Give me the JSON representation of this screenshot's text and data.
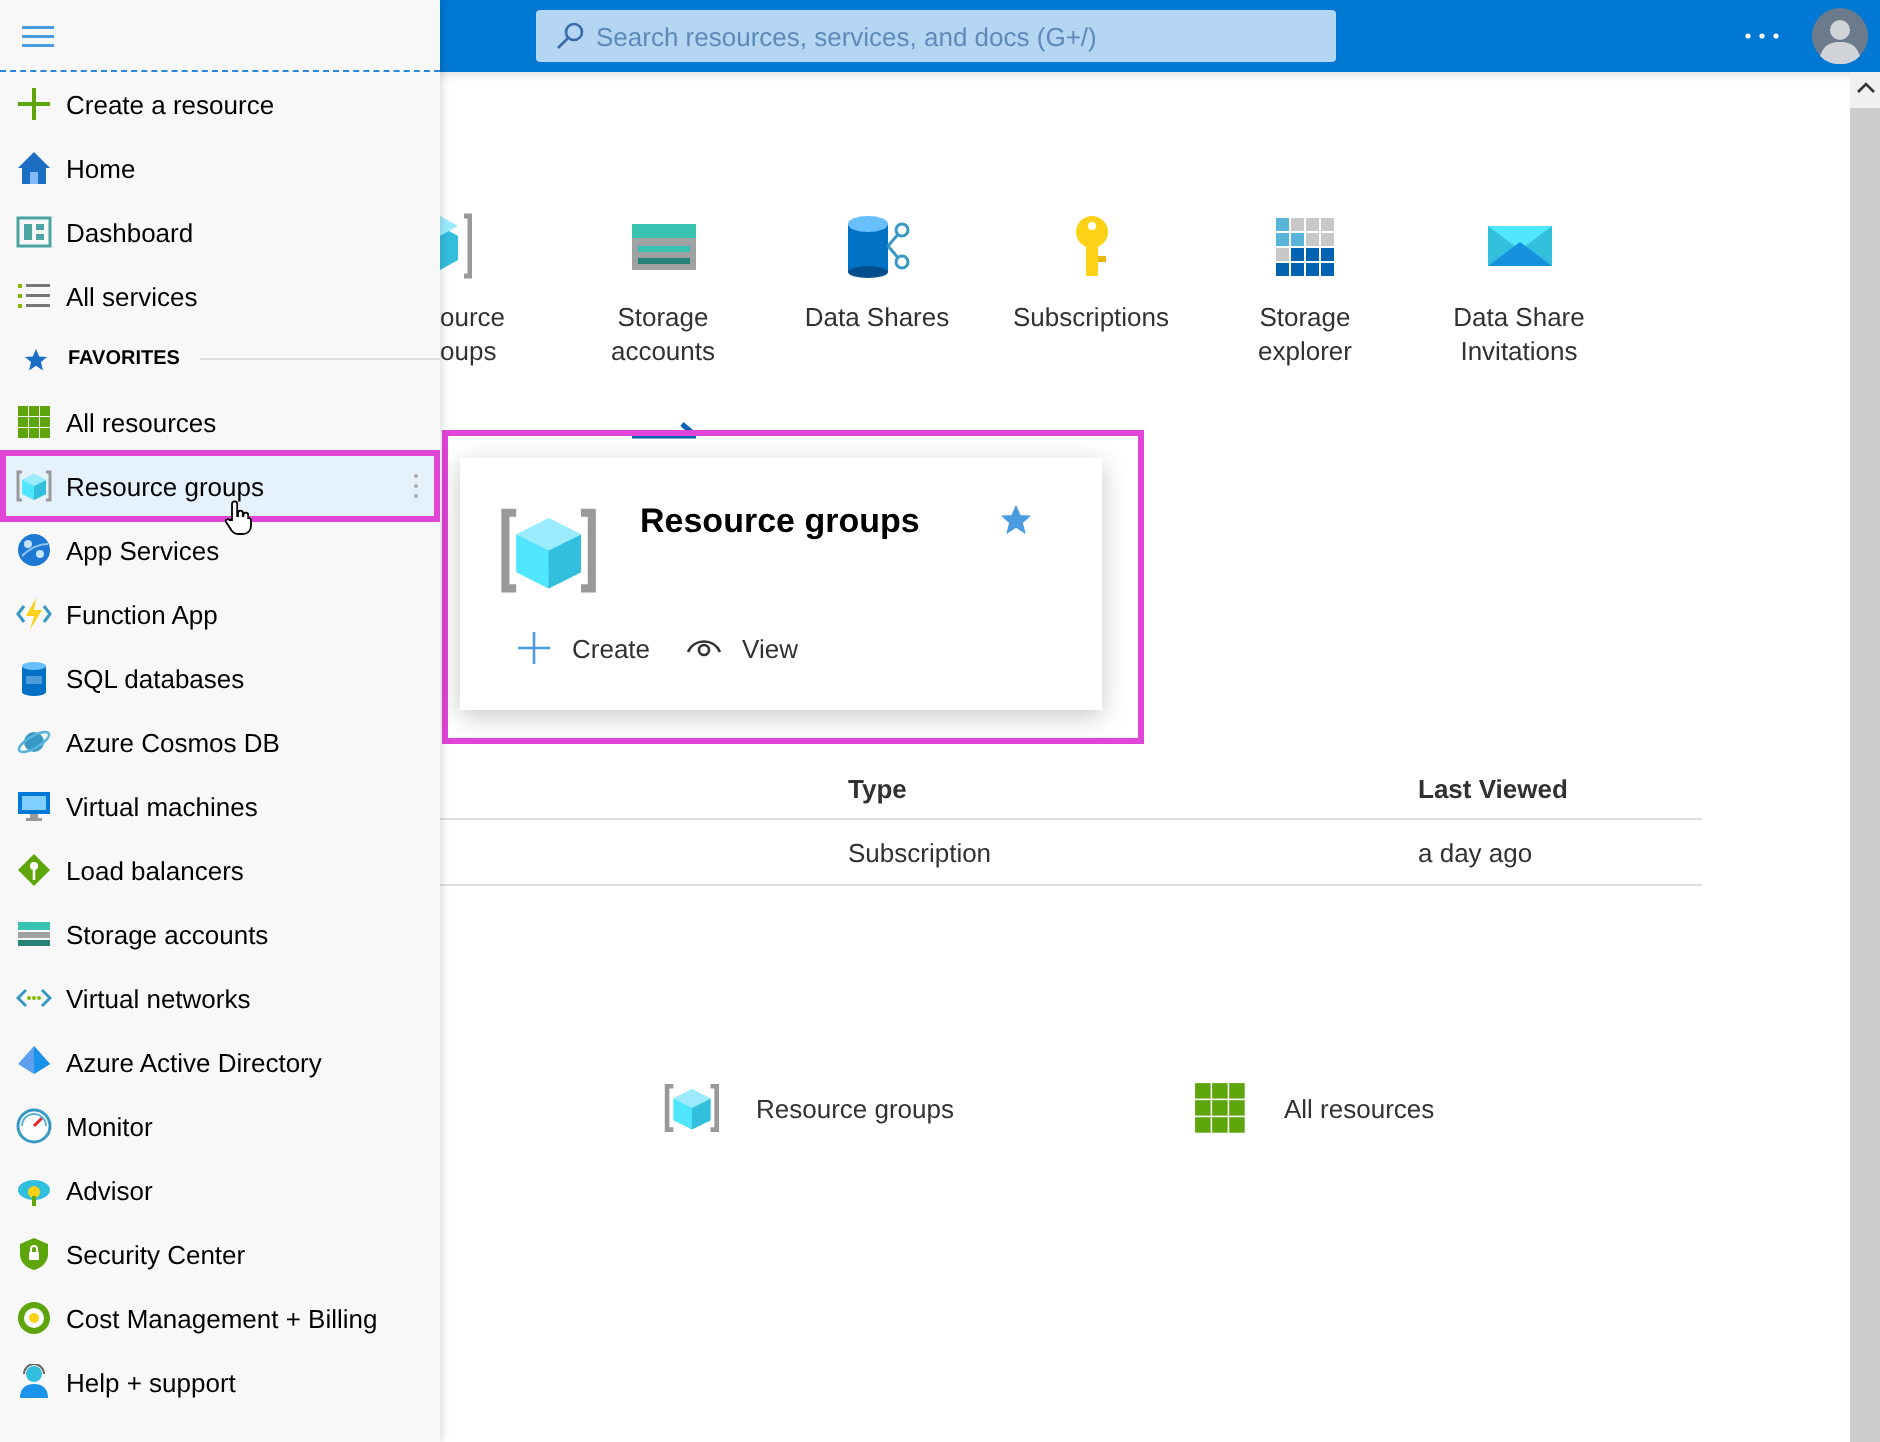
{
  "top_bar": {
    "search": {
      "placeholder": "Search resources, services, and docs (G+/)"
    }
  },
  "sidebar": {
    "items": [
      {
        "label": "Create a resource",
        "selected": false
      },
      {
        "label": "Home",
        "selected": false
      },
      {
        "label": "Dashboard",
        "selected": false
      },
      {
        "label": "All services",
        "selected": false
      }
    ],
    "favorites_heading": "FAVORITES",
    "favorites": [
      {
        "label": "All resources",
        "selected": false
      },
      {
        "label": "Resource groups",
        "selected": true
      },
      {
        "label": "App Services",
        "selected": false
      },
      {
        "label": "Function App",
        "selected": false
      },
      {
        "label": "SQL databases",
        "selected": false
      },
      {
        "label": "Azure Cosmos DB",
        "selected": false
      },
      {
        "label": "Virtual machines",
        "selected": false
      },
      {
        "label": "Load balancers",
        "selected": false
      },
      {
        "label": "Storage accounts",
        "selected": false
      },
      {
        "label": "Virtual networks",
        "selected": false
      },
      {
        "label": "Azure Active Directory",
        "selected": false
      },
      {
        "label": "Monitor",
        "selected": false
      },
      {
        "label": "Advisor",
        "selected": false
      },
      {
        "label": "Security Center",
        "selected": false
      },
      {
        "label": "Cost Management + Billing",
        "selected": false
      },
      {
        "label": "Help + support",
        "selected": false
      }
    ]
  },
  "services": [
    {
      "label": "ource oups"
    },
    {
      "label": "Storage accounts"
    },
    {
      "label": "Data Shares"
    },
    {
      "label": "Subscriptions"
    },
    {
      "label": "Storage explorer"
    },
    {
      "label": "Data Share Invitations"
    }
  ],
  "hover_card": {
    "title": "Resource groups",
    "favorite": true,
    "actions": [
      "Create",
      "View"
    ]
  },
  "recent": {
    "columns": [
      "Type",
      "Last Viewed"
    ],
    "rows": [
      [
        "Subscription",
        "a day ago"
      ]
    ]
  },
  "navigate": [
    "Resource groups",
    "All resources"
  ]
}
